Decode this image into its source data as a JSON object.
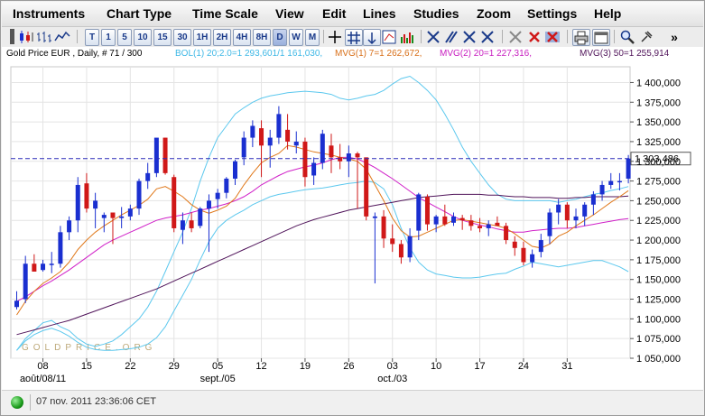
{
  "menu": [
    "Instruments",
    "Chart Type",
    "Time Scale",
    "View",
    "Edit",
    "Lines",
    "Studies",
    "Zoom",
    "Settings",
    "Help"
  ],
  "toolbar": {
    "timescale_buttons": [
      "T",
      "1",
      "5",
      "10",
      "15",
      "30",
      "1H",
      "2H",
      "4H",
      "8H",
      "D",
      "W",
      "M"
    ],
    "more_label": "»"
  },
  "header": {
    "title": "Gold Price EUR , Daily, # 71 / 300",
    "bol": "BOL(1) 20;2.0=1 293,601/1 161,030,",
    "mvg1": "MVG(1) 7=1 262,672,",
    "mvg2": "MVG(2) 20=1 227,316,",
    "mvg3": "MVG(3) 50=1 255,914"
  },
  "watermark": "GOLDPRICE.ORG",
  "status": {
    "timestamp": "07 nov. 2011 23:36:06 CET"
  },
  "colors": {
    "up": "#1a2fd0",
    "down": "#d01818",
    "bollinger": "#5cc8ee",
    "mvg1": "#e0781a",
    "mvg2": "#d020c8",
    "mvg3": "#50145a",
    "current_line": "#2a2ab8"
  },
  "chart_data": {
    "type": "candlestick",
    "title": "Gold Price EUR , Daily, # 71 / 300",
    "currency": "EUR",
    "ylim": [
      1050000,
      1420000
    ],
    "y_ticks": [
      1050000,
      1075000,
      1100000,
      1125000,
      1150000,
      1175000,
      1200000,
      1225000,
      1250000,
      1275000,
      1300000,
      1325000,
      1350000,
      1375000,
      1400000
    ],
    "y_tick_labels": [
      "1 050,000",
      "1 075,000",
      "1 100,000",
      "1 125,000",
      "1 150,000",
      "1 175,000",
      "1 200,000",
      "1 225,000",
      "1 250,000",
      "1 275,000",
      "1 300,000",
      "1 325,000",
      "1 350,000",
      "1 375,000",
      "1 400,000"
    ],
    "x_ticks": [
      {
        "index": 3,
        "label": "08",
        "sub": "août/08/11"
      },
      {
        "index": 8,
        "label": "15"
      },
      {
        "index": 13,
        "label": "22"
      },
      {
        "index": 18,
        "label": "29"
      },
      {
        "index": 23,
        "label": "05",
        "sub": "sept./05"
      },
      {
        "index": 28,
        "label": "12"
      },
      {
        "index": 33,
        "label": "19"
      },
      {
        "index": 38,
        "label": "26"
      },
      {
        "index": 43,
        "label": "03",
        "sub": "oct./03"
      },
      {
        "index": 48,
        "label": "10"
      },
      {
        "index": 53,
        "label": "17"
      },
      {
        "index": 58,
        "label": "24"
      },
      {
        "index": 63,
        "label": "31"
      }
    ],
    "current_price": 1303486,
    "current_price_label": "1 303,486",
    "ohlc": [
      [
        1115000,
        1135000,
        1112000,
        1123000
      ],
      [
        1125000,
        1180000,
        1120000,
        1170000
      ],
      [
        1170000,
        1182000,
        1160000,
        1160000
      ],
      [
        1162000,
        1175000,
        1160000,
        1170000
      ],
      [
        1170000,
        1185000,
        1158000,
        1170000
      ],
      [
        1170000,
        1218000,
        1165000,
        1210000
      ],
      [
        1210000,
        1230000,
        1200000,
        1225000
      ],
      [
        1225000,
        1280000,
        1210000,
        1270000
      ],
      [
        1272000,
        1285000,
        1235000,
        1240000
      ],
      [
        1240000,
        1260000,
        1215000,
        1250000
      ],
      [
        1228000,
        1235000,
        1210000,
        1232000
      ],
      [
        1235000,
        1235000,
        1195000,
        1228000
      ],
      [
        1228000,
        1242000,
        1215000,
        1230000
      ],
      [
        1230000,
        1245000,
        1225000,
        1240000
      ],
      [
        1240000,
        1278000,
        1232000,
        1275000
      ],
      [
        1275000,
        1298000,
        1265000,
        1285000
      ],
      [
        1285000,
        1320000,
        1280000,
        1330000
      ],
      [
        1330000,
        1330000,
        1283000,
        1285000
      ],
      [
        1280000,
        1283000,
        1210000,
        1215000
      ],
      [
        1213000,
        1235000,
        1195000,
        1225000
      ],
      [
        1225000,
        1235000,
        1210000,
        1215000
      ],
      [
        1218000,
        1242000,
        1215000,
        1240000
      ],
      [
        1240000,
        1258000,
        1185000,
        1250000
      ],
      [
        1252000,
        1265000,
        1240000,
        1260000
      ],
      [
        1260000,
        1280000,
        1253000,
        1278000
      ],
      [
        1278000,
        1302000,
        1270000,
        1300000
      ],
      [
        1305000,
        1338000,
        1295000,
        1330000
      ],
      [
        1330000,
        1352000,
        1318000,
        1345000
      ],
      [
        1342000,
        1352000,
        1280000,
        1320000
      ],
      [
        1320000,
        1340000,
        1292000,
        1330000
      ],
      [
        1330000,
        1370000,
        1322000,
        1360000
      ],
      [
        1340000,
        1360000,
        1315000,
        1325000
      ],
      [
        1320000,
        1338000,
        1310000,
        1325000
      ],
      [
        1325000,
        1330000,
        1268000,
        1280000
      ],
      [
        1282000,
        1305000,
        1270000,
        1298000
      ],
      [
        1298000,
        1340000,
        1290000,
        1335000
      ],
      [
        1320000,
        1335000,
        1285000,
        1305000
      ],
      [
        1305000,
        1322000,
        1290000,
        1300000
      ],
      [
        1300000,
        1320000,
        1280000,
        1310000
      ],
      [
        1310000,
        1312000,
        1240000,
        1305000
      ],
      [
        1305000,
        1305000,
        1225000,
        1230000
      ],
      [
        1228000,
        1235000,
        1145000,
        1230000
      ],
      [
        1230000,
        1238000,
        1190000,
        1202000
      ],
      [
        1202000,
        1220000,
        1185000,
        1195000
      ],
      [
        1195000,
        1200000,
        1170000,
        1178000
      ],
      [
        1178000,
        1215000,
        1172000,
        1205000
      ],
      [
        1212000,
        1260000,
        1200000,
        1258000
      ],
      [
        1255000,
        1258000,
        1212000,
        1220000
      ],
      [
        1220000,
        1232000,
        1210000,
        1230000
      ],
      [
        1230000,
        1245000,
        1218000,
        1220000
      ],
      [
        1222000,
        1235000,
        1218000,
        1230000
      ],
      [
        1228000,
        1232000,
        1213000,
        1225000
      ],
      [
        1225000,
        1232000,
        1212000,
        1218000
      ],
      [
        1218000,
        1228000,
        1210000,
        1215000
      ],
      [
        1215000,
        1225000,
        1205000,
        1220000
      ],
      [
        1222000,
        1230000,
        1218000,
        1218000
      ],
      [
        1218000,
        1222000,
        1195000,
        1200000
      ],
      [
        1198000,
        1205000,
        1180000,
        1190000
      ],
      [
        1190000,
        1198000,
        1168000,
        1172000
      ],
      [
        1172000,
        1188000,
        1165000,
        1182000
      ],
      [
        1185000,
        1208000,
        1178000,
        1200000
      ],
      [
        1205000,
        1240000,
        1195000,
        1235000
      ],
      [
        1235000,
        1252000,
        1220000,
        1245000
      ],
      [
        1245000,
        1248000,
        1215000,
        1225000
      ],
      [
        1225000,
        1240000,
        1215000,
        1230000
      ],
      [
        1230000,
        1248000,
        1218000,
        1245000
      ],
      [
        1245000,
        1262000,
        1232000,
        1258000
      ],
      [
        1258000,
        1275000,
        1250000,
        1270000
      ],
      [
        1270000,
        1285000,
        1265000,
        1275000
      ],
      [
        1275000,
        1285000,
        1263000,
        1275000
      ],
      [
        1278000,
        1308000,
        1272000,
        1303486
      ]
    ],
    "bollinger_upper": [
      1060000,
      1075000,
      1085000,
      1095000,
      1098000,
      1090000,
      1085000,
      1075000,
      1068000,
      1065000,
      1068000,
      1072000,
      1080000,
      1090000,
      1100000,
      1115000,
      1135000,
      1160000,
      1185000,
      1210000,
      1240000,
      1275000,
      1305000,
      1330000,
      1345000,
      1360000,
      1368000,
      1375000,
      1380000,
      1383000,
      1385000,
      1387000,
      1388000,
      1389000,
      1388000,
      1387000,
      1385000,
      1380000,
      1378000,
      1380000,
      1383000,
      1385000,
      1390000,
      1398000,
      1405000,
      1408000,
      1400000,
      1390000,
      1378000,
      1360000,
      1340000,
      1318000,
      1300000,
      1285000,
      1270000,
      1258000,
      1252000,
      1250000,
      1250000,
      1250000,
      1250000,
      1250000,
      1248000,
      1250000,
      1252000,
      1255000,
      1258000,
      1260000,
      1263000,
      1265000,
      1268000
    ],
    "bollinger_lower": [
      1060000,
      1072000,
      1080000,
      1085000,
      1088000,
      1084000,
      1078000,
      1070000,
      1064000,
      1061000,
      1060000,
      1060000,
      1061000,
      1062000,
      1064000,
      1068000,
      1076000,
      1090000,
      1110000,
      1130000,
      1150000,
      1175000,
      1198000,
      1215000,
      1225000,
      1232000,
      1238000,
      1245000,
      1250000,
      1255000,
      1258000,
      1260000,
      1262000,
      1264000,
      1265000,
      1266000,
      1268000,
      1270000,
      1272000,
      1273000,
      1275000,
      1273000,
      1265000,
      1245000,
      1215000,
      1190000,
      1172000,
      1162000,
      1157000,
      1155000,
      1153000,
      1152000,
      1152000,
      1153000,
      1155000,
      1157000,
      1158000,
      1163000,
      1167000,
      1172000,
      1170000,
      1168000,
      1166000,
      1168000,
      1170000,
      1172000,
      1174000,
      1174000,
      1170000,
      1166000,
      1160000
    ],
    "mvg1": [
      1105000,
      1122000,
      1135000,
      1145000,
      1152000,
      1160000,
      1172000,
      1188000,
      1200000,
      1210000,
      1218000,
      1225000,
      1232000,
      1238000,
      1244000,
      1252000,
      1265000,
      1268000,
      1262000,
      1255000,
      1245000,
      1238000,
      1234000,
      1238000,
      1243000,
      1253000,
      1270000,
      1285000,
      1298000,
      1305000,
      1310000,
      1320000,
      1318000,
      1315000,
      1312000,
      1310000,
      1308000,
      1305000,
      1303000,
      1300000,
      1290000,
      1270000,
      1250000,
      1228000,
      1212000,
      1204000,
      1205000,
      1210000,
      1215000,
      1220000,
      1225000,
      1226000,
      1224000,
      1222000,
      1220000,
      1218000,
      1215000,
      1208000,
      1200000,
      1192000,
      1190000,
      1195000,
      1205000,
      1210000,
      1218000,
      1225000,
      1232000,
      1240000,
      1248000,
      1255000,
      1262672
    ],
    "mvg2": [
      1122000,
      1128000,
      1135000,
      1142000,
      1148000,
      1155000,
      1162000,
      1170000,
      1178000,
      1186000,
      1194000,
      1200000,
      1205000,
      1210000,
      1215000,
      1220000,
      1225000,
      1228000,
      1230000,
      1232000,
      1235000,
      1238000,
      1240000,
      1243000,
      1246000,
      1250000,
      1255000,
      1262000,
      1270000,
      1276000,
      1282000,
      1287000,
      1290000,
      1293000,
      1295000,
      1298000,
      1302000,
      1305000,
      1305000,
      1303000,
      1298000,
      1292000,
      1285000,
      1278000,
      1270000,
      1262000,
      1254000,
      1248000,
      1242000,
      1236000,
      1230000,
      1225000,
      1222000,
      1219000,
      1217000,
      1214000,
      1212000,
      1210000,
      1210000,
      1212000,
      1213000,
      1214000,
      1215000,
      1215000,
      1216000,
      1218000,
      1220000,
      1222000,
      1224000,
      1226000,
      1227316
    ],
    "mvg3": [
      1080000,
      1083000,
      1086000,
      1089000,
      1092000,
      1095000,
      1098000,
      1102000,
      1106000,
      1110000,
      1114000,
      1118000,
      1122000,
      1126000,
      1130000,
      1134000,
      1138000,
      1143000,
      1148000,
      1153000,
      1158000,
      1163000,
      1168000,
      1173000,
      1178000,
      1183000,
      1188000,
      1193000,
      1198000,
      1203000,
      1208000,
      1213000,
      1218000,
      1222000,
      1226000,
      1229000,
      1232000,
      1235000,
      1238000,
      1240000,
      1242000,
      1244000,
      1246000,
      1248000,
      1250000,
      1252000,
      1254000,
      1255000,
      1256000,
      1257000,
      1258000,
      1258000,
      1258000,
      1258000,
      1257000,
      1257000,
      1256000,
      1255000,
      1255000,
      1254000,
      1254000,
      1254000,
      1253000,
      1253000,
      1254000,
      1254000,
      1255000,
      1255000,
      1255000,
      1255000,
      1255914
    ]
  }
}
